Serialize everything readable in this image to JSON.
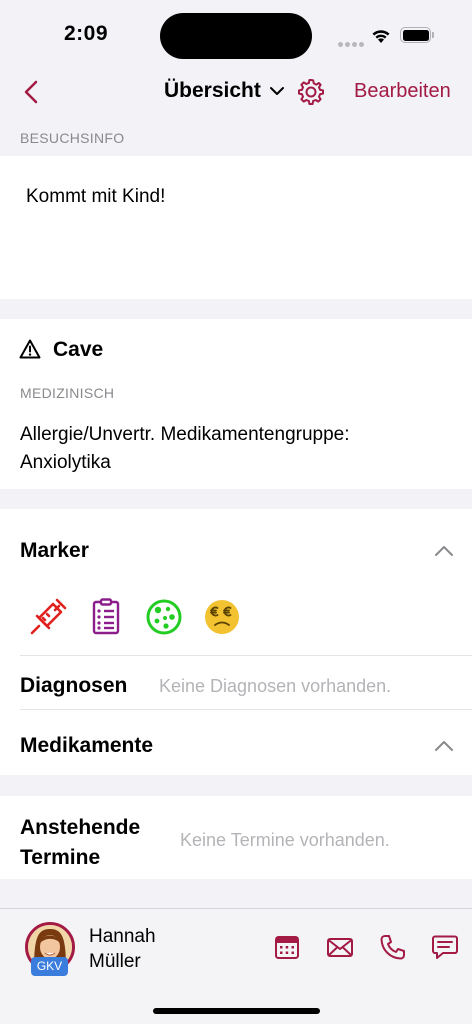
{
  "status": {
    "time": "2:09"
  },
  "nav": {
    "title": "Übersicht",
    "edit_label": "Bearbeiten"
  },
  "visit": {
    "section_label": "BESUCHSINFO",
    "text": "Kommt mit Kind!"
  },
  "cave": {
    "title": "Cave",
    "subsection_label": "MEDIZINISCH",
    "lines": [
      "Allergie/Unvertr. Medikamentengruppe:",
      "Anxiolytika"
    ]
  },
  "marker": {
    "title": "Marker",
    "icons": [
      {
        "name": "syringe-icon",
        "color": "#e0211d"
      },
      {
        "name": "clipboard-list-icon",
        "color": "#8b1e8b"
      },
      {
        "name": "germ-icon",
        "color": "#22cc22"
      },
      {
        "name": "euro-worried-face-icon",
        "color": "#f2c230"
      }
    ]
  },
  "diagnosen": {
    "title": "Diagnosen",
    "empty_text": "Keine Diagnosen vorhanden."
  },
  "medikamente": {
    "title": "Medikamente"
  },
  "termine": {
    "title_line1": "Anstehende",
    "title_line2": "Termine",
    "empty_text": "Keine Termine vorhanden."
  },
  "patient": {
    "first_name": "Hannah",
    "last_name": "Müller",
    "insurance_badge": "GKV"
  },
  "tabbar": {
    "icons": [
      "calendar-icon",
      "mail-icon",
      "phone-icon",
      "chat-icon"
    ]
  },
  "colors": {
    "accent": "#a31a44",
    "background": "#f2f2f7",
    "secondary_text": "#8a8a8e"
  }
}
